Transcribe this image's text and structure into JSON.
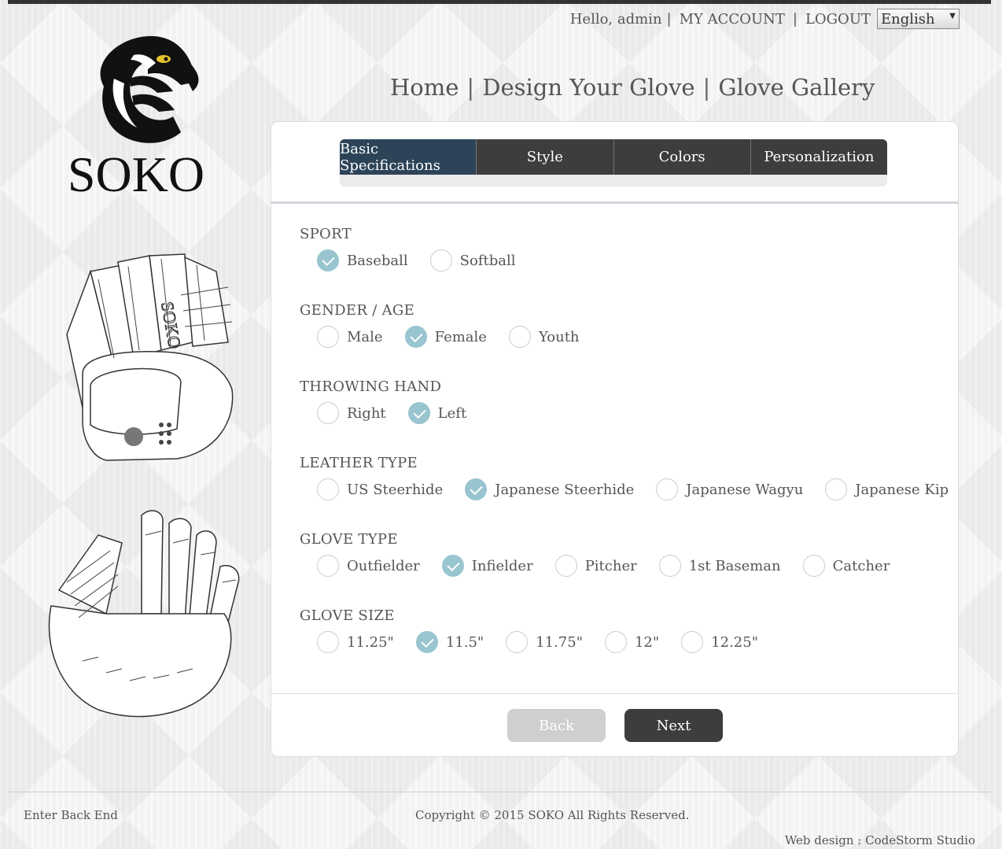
{
  "header": {
    "greeting": "Hello, admin",
    "my_account": "MY ACCOUNT",
    "logout": "LOGOUT",
    "language": "English"
  },
  "logo": {
    "text": "SOKO"
  },
  "nav": {
    "home": "Home",
    "design": "Design Your Glove",
    "gallery": "Glove Gallery"
  },
  "tabs": [
    {
      "label": "Basic Specifications",
      "active": true
    },
    {
      "label": "Style",
      "active": false
    },
    {
      "label": "Colors",
      "active": false
    },
    {
      "label": "Personalization",
      "active": false
    }
  ],
  "sections": [
    {
      "title": "SPORT",
      "options": [
        {
          "label": "Baseball",
          "checked": true
        },
        {
          "label": "Softball",
          "checked": false
        }
      ]
    },
    {
      "title": "GENDER / AGE",
      "options": [
        {
          "label": "Male",
          "checked": false
        },
        {
          "label": "Female",
          "checked": true
        },
        {
          "label": "Youth",
          "checked": false
        }
      ]
    },
    {
      "title": "THROWING HAND",
      "options": [
        {
          "label": "Right",
          "checked": false
        },
        {
          "label": "Left",
          "checked": true
        }
      ]
    },
    {
      "title": "LEATHER TYPE",
      "options": [
        {
          "label": "US Steerhide",
          "checked": false
        },
        {
          "label": "Japanese Steerhide",
          "checked": true
        },
        {
          "label": "Japanese Wagyu",
          "checked": false
        },
        {
          "label": "Japanese Kip",
          "checked": false
        }
      ]
    },
    {
      "title": "GLOVE TYPE",
      "options": [
        {
          "label": "Outfielder",
          "checked": false
        },
        {
          "label": "Infielder",
          "checked": true
        },
        {
          "label": "Pitcher",
          "checked": false
        },
        {
          "label": "1st Baseman",
          "checked": false
        },
        {
          "label": "Catcher",
          "checked": false
        }
      ]
    },
    {
      "title": "GLOVE SIZE",
      "options": [
        {
          "label": "11.25\"",
          "checked": false
        },
        {
          "label": "11.5\"",
          "checked": true
        },
        {
          "label": "11.75\"",
          "checked": false
        },
        {
          "label": "12\"",
          "checked": false
        },
        {
          "label": "12.25\"",
          "checked": false
        }
      ]
    }
  ],
  "buttons": {
    "back": "Back",
    "next": "Next"
  },
  "footer": {
    "back_end": "Enter Back End",
    "copyright": "Copyright © 2015 SOKO All Rights Reserved.",
    "credit": "Web design : CodeStorm Studio"
  },
  "colors": {
    "tab_active": "#2d4458",
    "tab": "#3d3d3d",
    "radio_checked": "#98c5cf"
  }
}
